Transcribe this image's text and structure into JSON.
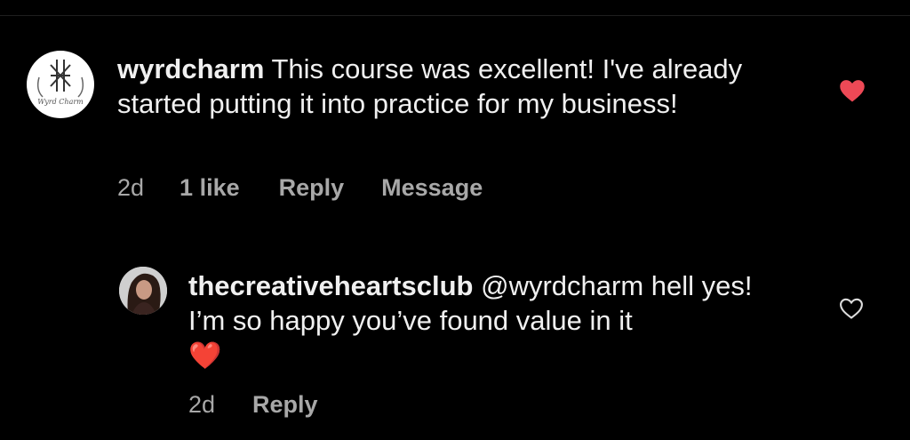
{
  "comments": [
    {
      "username": "wyrdcharm",
      "text": " This course was excellent! I've already started putting it into practice for my business!",
      "avatar_text": "Wyrd Charm",
      "time": "2d",
      "likes": "1 like",
      "reply_label": "Reply",
      "message_label": "Message",
      "liked": true,
      "like_color": "#ed4956"
    },
    {
      "username": "thecreativeheartsclub",
      "text": " @wyrdcharm hell yes! I’m so happy you’ve found value in it",
      "emoji": "❤️",
      "time": "2d",
      "reply_label": "Reply",
      "liked": false
    }
  ]
}
